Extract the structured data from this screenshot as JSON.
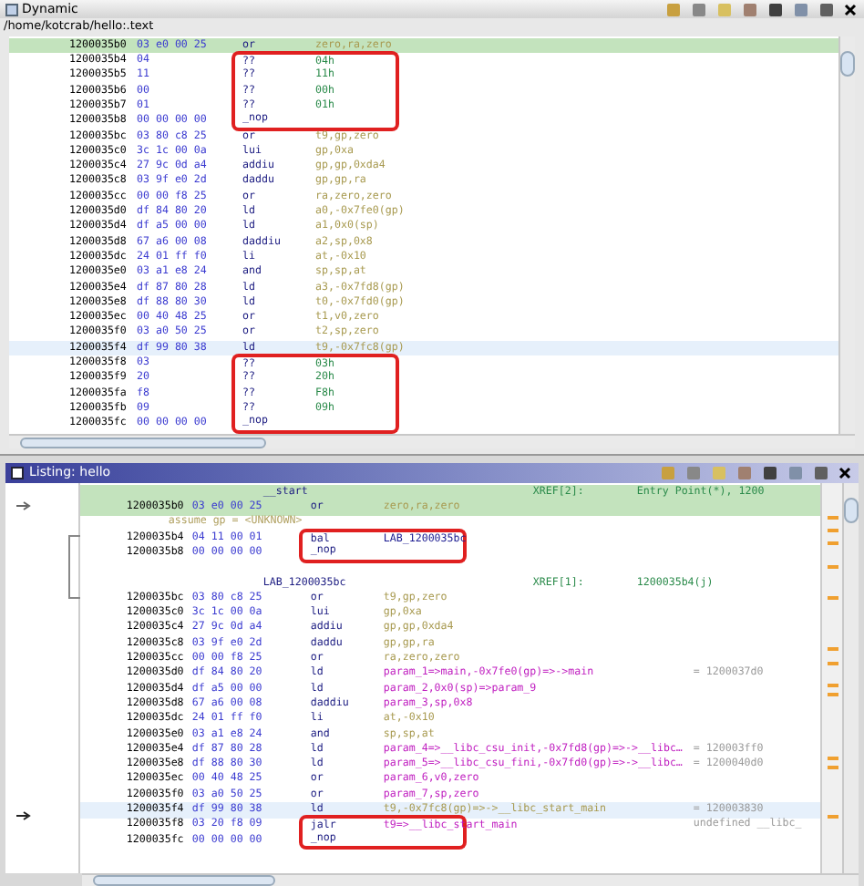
{
  "dynamic_panel": {
    "title": "Dynamic",
    "path": "/home/kotcrab/hello:.text",
    "rows": [
      {
        "address": "1200035b0",
        "bytes": "03 e0 00 25",
        "mnemonic": "or",
        "operands": "zero,ra,zero",
        "color": "#a89a50",
        "highlighted": true,
        "selected": false,
        "boxed": false
      },
      {
        "address": "1200035b4",
        "bytes": "04",
        "mnemonic": "??",
        "operands": "04h",
        "color": "#2a8a4a",
        "highlighted": false,
        "selected": false,
        "boxed": true
      },
      {
        "address": "1200035b5",
        "bytes": "11",
        "mnemonic": "??",
        "operands": "11h",
        "color": "#2a8a4a",
        "highlighted": false,
        "selected": false,
        "boxed": true
      },
      {
        "address": "1200035b6",
        "bytes": "00",
        "mnemonic": "??",
        "operands": "00h",
        "color": "#2a8a4a",
        "highlighted": false,
        "selected": false,
        "boxed": true
      },
      {
        "address": "1200035b7",
        "bytes": "01",
        "mnemonic": "??",
        "operands": "01h",
        "color": "#2a8a4a",
        "highlighted": false,
        "selected": false,
        "boxed": true
      },
      {
        "address": "1200035b8",
        "bytes": "00 00 00 00",
        "mnemonic": "_nop",
        "highlighted": false,
        "selected": false,
        "boxed": true
      },
      {
        "address": "1200035bc",
        "bytes": "03 80 c8 25",
        "mnemonic": "or",
        "operands": "t9,gp,zero",
        "color": "#a89a50",
        "highlighted": false,
        "selected": false,
        "boxed": false
      },
      {
        "address": "1200035c0",
        "bytes": "3c 1c 00 0a",
        "mnemonic": "lui",
        "operands": "gp,0xa",
        "color": "#a89a50",
        "highlighted": false,
        "selected": false,
        "boxed": false
      },
      {
        "address": "1200035c4",
        "bytes": "27 9c 0d a4",
        "mnemonic": "addiu",
        "operands": "gp,gp,0xda4",
        "color": "#a89a50",
        "highlighted": false,
        "selected": false,
        "boxed": false
      },
      {
        "address": "1200035c8",
        "bytes": "03 9f e0 2d",
        "mnemonic": "daddu",
        "operands": "gp,gp,ra",
        "color": "#a89a50",
        "highlighted": false,
        "selected": false,
        "boxed": false
      },
      {
        "address": "1200035cc",
        "bytes": "00 00 f8 25",
        "mnemonic": "or",
        "operands": "ra,zero,zero",
        "color": "#a89a50",
        "highlighted": false,
        "selected": false,
        "boxed": false
      },
      {
        "address": "1200035d0",
        "bytes": "df 84 80 20",
        "mnemonic": "ld",
        "operands": "a0,-0x7fe0(gp)",
        "color": "#a89a50",
        "highlighted": false,
        "selected": false,
        "boxed": false
      },
      {
        "address": "1200035d4",
        "bytes": "df a5 00 00",
        "mnemonic": "ld",
        "operands": "a1,0x0(sp)",
        "color": "#a89a50",
        "highlighted": false,
        "selected": false,
        "boxed": false
      },
      {
        "address": "1200035d8",
        "bytes": "67 a6 00 08",
        "mnemonic": "daddiu",
        "operands": "a2,sp,0x8",
        "color": "#a89a50",
        "highlighted": false,
        "selected": false,
        "boxed": false
      },
      {
        "address": "1200035dc",
        "bytes": "24 01 ff f0",
        "mnemonic": "li",
        "operands": "at,-0x10",
        "color": "#a89a50",
        "highlighted": false,
        "selected": false,
        "boxed": false
      },
      {
        "address": "1200035e0",
        "bytes": "03 a1 e8 24",
        "mnemonic": "and",
        "operands": "sp,sp,at",
        "color": "#a89a50",
        "highlighted": false,
        "selected": false,
        "boxed": false
      },
      {
        "address": "1200035e4",
        "bytes": "df 87 80 28",
        "mnemonic": "ld",
        "operands": "a3,-0x7fd8(gp)",
        "color": "#a89a50",
        "highlighted": false,
        "selected": false,
        "boxed": false
      },
      {
        "address": "1200035e8",
        "bytes": "df 88 80 30",
        "mnemonic": "ld",
        "operands": "t0,-0x7fd0(gp)",
        "color": "#a89a50",
        "highlighted": false,
        "selected": false,
        "boxed": false
      },
      {
        "address": "1200035ec",
        "bytes": "00 40 48 25",
        "mnemonic": "or",
        "operands": "t1,v0,zero",
        "color": "#a89a50",
        "highlighted": false,
        "selected": false,
        "boxed": false
      },
      {
        "address": "1200035f0",
        "bytes": "03 a0 50 25",
        "mnemonic": "or",
        "operands": "t2,sp,zero",
        "color": "#a89a50",
        "highlighted": false,
        "selected": false,
        "boxed": false
      },
      {
        "address": "1200035f4",
        "bytes": "df 99 80 38",
        "mnemonic": "ld",
        "operands": "t9,-0x7fc8(gp)",
        "color": "#a89a50",
        "highlighted": false,
        "selected": true,
        "boxed": false
      },
      {
        "address": "1200035f8",
        "bytes": "03",
        "mnemonic": "??",
        "operands": "03h",
        "color": "#2a8a4a",
        "highlighted": false,
        "selected": false,
        "boxed": true
      },
      {
        "address": "1200035f9",
        "bytes": "20",
        "mnemonic": "??",
        "operands": "20h",
        "color": "#2a8a4a",
        "highlighted": false,
        "selected": false,
        "boxed": true
      },
      {
        "address": "1200035fa",
        "bytes": "f8",
        "mnemonic": "??",
        "operands": "F8h",
        "color": "#2a8a4a",
        "highlighted": false,
        "selected": false,
        "boxed": true
      },
      {
        "address": "1200035fb",
        "bytes": "09",
        "mnemonic": "??",
        "operands": "09h",
        "color": "#2a8a4a",
        "highlighted": false,
        "selected": false,
        "boxed": true
      },
      {
        "address": "1200035fc",
        "bytes": "00 00 00 00",
        "mnemonic": "_nop",
        "highlighted": false,
        "selected": false,
        "boxed": true
      }
    ]
  },
  "listing_panel": {
    "title": "Listing: hello",
    "rows": [
      {
        "kind": "label",
        "label": "__start",
        "xref_label": "XREF[2]:",
        "xref_value": "Entry Point(*), 1200",
        "highlighted": true
      },
      {
        "kind": "instruction",
        "address": "1200035b0",
        "bytes": "03 e0 00 25",
        "mnemonic": "or",
        "operands": "zero,ra,zero",
        "color": "#a89a50",
        "highlighted": true,
        "selected": false,
        "boxed": false
      },
      {
        "kind": "assume",
        "text": "assume gp = <UNKNOWN>"
      },
      {
        "kind": "instruction",
        "address": "1200035b4",
        "bytes": "04 11 00 01",
        "mnemonic": "bal",
        "operands": "LAB_1200035bc",
        "color": "#1a1a90",
        "highlighted": false,
        "selected": false,
        "boxed": true
      },
      {
        "kind": "instruction",
        "address": "1200035b8",
        "bytes": "00 00 00 00",
        "mnemonic": "_nop",
        "highlighted": false,
        "selected": false,
        "boxed": true
      },
      {
        "kind": "blank"
      },
      {
        "kind": "label",
        "label": "LAB_1200035bc",
        "xref_label": "XREF[1]:",
        "xref_value": "1200035b4(j)",
        "highlighted": false
      },
      {
        "kind": "instruction",
        "address": "1200035bc",
        "bytes": "03 80 c8 25",
        "mnemonic": "or",
        "operands": "t9,gp,zero",
        "color": "#a89a50",
        "highlighted": false,
        "selected": false,
        "boxed": false
      },
      {
        "kind": "instruction",
        "address": "1200035c0",
        "bytes": "3c 1c 00 0a",
        "mnemonic": "lui",
        "operands": "gp,0xa",
        "color": "#a89a50",
        "highlighted": false,
        "selected": false,
        "boxed": false
      },
      {
        "kind": "instruction",
        "address": "1200035c4",
        "bytes": "27 9c 0d a4",
        "mnemonic": "addiu",
        "operands": "gp,gp,0xda4",
        "color": "#a89a50",
        "highlighted": false,
        "selected": false,
        "boxed": false
      },
      {
        "kind": "instruction",
        "address": "1200035c8",
        "bytes": "03 9f e0 2d",
        "mnemonic": "daddu",
        "operands": "gp,gp,ra",
        "color": "#a89a50",
        "highlighted": false,
        "selected": false,
        "boxed": false
      },
      {
        "kind": "instruction",
        "address": "1200035cc",
        "bytes": "00 00 f8 25",
        "mnemonic": "or",
        "operands": "ra,zero,zero",
        "color": "#a89a50",
        "highlighted": false,
        "selected": false,
        "boxed": false
      },
      {
        "kind": "instruction",
        "address": "1200035d0",
        "bytes": "df 84 80 20",
        "mnemonic": "ld",
        "operands": "param_1=>main,-0x7fe0(gp)=>->main",
        "color": "#c020c0",
        "comment": "= 1200037d0",
        "highlighted": false,
        "selected": false,
        "boxed": false
      },
      {
        "kind": "instruction",
        "address": "1200035d4",
        "bytes": "df a5 00 00",
        "mnemonic": "ld",
        "operands": "param_2,0x0(sp)=>param_9",
        "color": "#c020c0",
        "highlighted": false,
        "selected": false,
        "boxed": false
      },
      {
        "kind": "instruction",
        "address": "1200035d8",
        "bytes": "67 a6 00 08",
        "mnemonic": "daddiu",
        "operands": "param_3,sp,0x8",
        "color": "#c020c0",
        "highlighted": false,
        "selected": false,
        "boxed": false
      },
      {
        "kind": "instruction",
        "address": "1200035dc",
        "bytes": "24 01 ff f0",
        "mnemonic": "li",
        "operands": "at,-0x10",
        "color": "#a89a50",
        "highlighted": false,
        "selected": false,
        "boxed": false
      },
      {
        "kind": "instruction",
        "address": "1200035e0",
        "bytes": "03 a1 e8 24",
        "mnemonic": "and",
        "operands": "sp,sp,at",
        "color": "#a89a50",
        "highlighted": false,
        "selected": false,
        "boxed": false
      },
      {
        "kind": "instruction",
        "address": "1200035e4",
        "bytes": "df 87 80 28",
        "mnemonic": "ld",
        "operands": "param_4=>__libc_csu_init,-0x7fd8(gp)=>->__libc…",
        "color": "#c020c0",
        "comment": "= 120003ff0",
        "highlighted": false,
        "selected": false,
        "boxed": false
      },
      {
        "kind": "instruction",
        "address": "1200035e8",
        "bytes": "df 88 80 30",
        "mnemonic": "ld",
        "operands": "param_5=>__libc_csu_fini,-0x7fd0(gp)=>->__libc…",
        "color": "#c020c0",
        "comment": "= 1200040d0",
        "highlighted": false,
        "selected": false,
        "boxed": false
      },
      {
        "kind": "instruction",
        "address": "1200035ec",
        "bytes": "00 40 48 25",
        "mnemonic": "or",
        "operands": "param_6,v0,zero",
        "color": "#c020c0",
        "highlighted": false,
        "selected": false,
        "boxed": false
      },
      {
        "kind": "instruction",
        "address": "1200035f0",
        "bytes": "03 a0 50 25",
        "mnemonic": "or",
        "operands": "param_7,sp,zero",
        "color": "#c020c0",
        "highlighted": false,
        "selected": false,
        "boxed": false
      },
      {
        "kind": "instruction",
        "address": "1200035f4",
        "bytes": "df 99 80 38",
        "mnemonic": "ld",
        "operands": "t9,-0x7fc8(gp)=>->__libc_start_main",
        "color": "#a89a50",
        "comment": "= 120003830",
        "highlighted": false,
        "selected": true,
        "boxed": false
      },
      {
        "kind": "instruction",
        "address": "1200035f8",
        "bytes": "03 20 f8 09",
        "mnemonic": "jalr",
        "operands": "t9=>__libc_start_main",
        "color": "#c020c0",
        "comment": "undefined __libc_",
        "highlighted": false,
        "selected": false,
        "boxed": true
      },
      {
        "kind": "instruction",
        "address": "1200035fc",
        "bytes": "00 00 00 00",
        "mnemonic": "_nop",
        "highlighted": false,
        "selected": false,
        "boxed": true
      }
    ]
  }
}
